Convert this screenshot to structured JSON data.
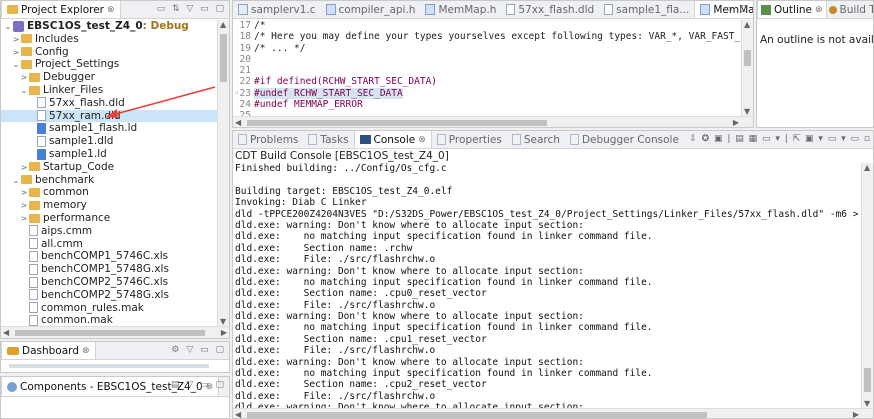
{
  "project_explorer": {
    "tab_label": "Project Explorer",
    "tab_close": "⊗",
    "items": [
      {
        "label": "EBSC1OS_test_Z4_0",
        "suffix": ": Debug",
        "icon": "project-icon",
        "twisty": "⌄"
      },
      {
        "label": "Includes",
        "icon": "includes-icon",
        "twisty": ">"
      },
      {
        "label": "Config",
        "icon": "folder-icon",
        "twisty": ">"
      },
      {
        "label": "Project_Settings",
        "icon": "folder-icon",
        "twisty": "⌄"
      },
      {
        "label": "Debugger",
        "icon": "folder-icon",
        "twisty": ">"
      },
      {
        "label": "Linker_Files",
        "icon": "folder-icon",
        "twisty": "⌄"
      },
      {
        "label": "57xx_flash.dld",
        "icon": "file-icon",
        "twisty": ""
      },
      {
        "label": "57xx_ram.dld",
        "icon": "file-icon",
        "twisty": ""
      },
      {
        "label": "sample1_flash.ld",
        "icon": "ld-file-icon",
        "twisty": ""
      },
      {
        "label": "sample1.dld",
        "icon": "file-icon",
        "twisty": ""
      },
      {
        "label": "sample1.ld",
        "icon": "ld-file-icon",
        "twisty": ""
      },
      {
        "label": "Startup_Code",
        "icon": "folder-icon",
        "twisty": ">"
      },
      {
        "label": "benchmark",
        "icon": "folder-icon",
        "twisty": "⌄"
      },
      {
        "label": "common",
        "icon": "folder-icon",
        "twisty": ">"
      },
      {
        "label": "memory",
        "icon": "folder-icon",
        "twisty": ">"
      },
      {
        "label": "performance",
        "icon": "folder-icon",
        "twisty": ">"
      },
      {
        "label": "aips.cmm",
        "icon": "file-icon",
        "twisty": ""
      },
      {
        "label": "all.cmm",
        "icon": "file-icon",
        "twisty": ""
      },
      {
        "label": "benchCOMP1_5746C.xls",
        "icon": "file-icon",
        "twisty": ""
      },
      {
        "label": "benchCOMP1_5748G.xls",
        "icon": "file-icon",
        "twisty": ""
      },
      {
        "label": "benchCOMP2_5746C.xls",
        "icon": "file-icon",
        "twisty": ""
      },
      {
        "label": "benchCOMP2_5748G.xls",
        "icon": "file-icon",
        "twisty": ""
      },
      {
        "label": "common_rules.mak",
        "icon": "file-icon",
        "twisty": ""
      },
      {
        "label": "common.mak",
        "icon": "file-icon",
        "twisty": ""
      }
    ]
  },
  "dashboard": {
    "tab_label": "Dashboard",
    "tab_close": "⊗"
  },
  "components": {
    "tab_label": "Components - EBSC1OS_test_Z4_0",
    "tab_close": "⊗"
  },
  "editor": {
    "tabs": [
      {
        "label": "samplerv1.c",
        "icon": "c-file-icon"
      },
      {
        "label": "compiler_api.h",
        "icon": "h-file-icon"
      },
      {
        "label": "MemMap.h",
        "icon": "h-file-icon"
      },
      {
        "label": "57xx_flash.dld",
        "icon": "file-icon"
      },
      {
        "label": "sample1_fla...",
        "icon": "file-icon"
      },
      {
        "label": "MemMap.h",
        "icon": "h-file-icon",
        "active": true,
        "close": "⊗"
      }
    ],
    "overflow": "»¹¹",
    "lines": [
      {
        "num": "17",
        "text": "/*"
      },
      {
        "num": "18",
        "text": "/* Here you may define your types yourselves except following types: VAR_*, VAR_FAST_*, CONST_*"
      },
      {
        "num": "19",
        "text": "/* ... */"
      },
      {
        "num": "20",
        "text": ""
      },
      {
        "num": "21",
        "text": ""
      },
      {
        "num": "22",
        "text": "#if defined(RCHW_START_SEC_DATA)"
      },
      {
        "num": "◦23",
        "text": "#undef RCHW_START_SEC_DATA"
      },
      {
        "num": "24",
        "text": "#undef MEMMAP_ERROR"
      },
      {
        "num": "25",
        "text": ""
      }
    ]
  },
  "outline": {
    "tab_label": "Outline",
    "tab_close": "⊗",
    "build_tab": "Build Ta...",
    "overflow": "»",
    "message": "An outline is not available."
  },
  "console": {
    "tabs": [
      {
        "label": "Problems",
        "icon": "problems-icon"
      },
      {
        "label": "Tasks",
        "icon": "tasks-icon"
      },
      {
        "label": "Console",
        "icon": "console-icon",
        "active": true,
        "close": "⊗"
      },
      {
        "label": "Properties",
        "icon": "properties-icon"
      },
      {
        "label": "Search",
        "icon": "search-icon"
      },
      {
        "label": "Debugger Console",
        "icon": "debugger-console-icon"
      }
    ],
    "title": "CDT Build Console [EBSC1OS_test_Z4_0]",
    "lines": [
      "Finished building: ../Config/Os_cfg.c",
      " ",
      "Building target: EBSC1OS_test_Z4_0.elf",
      "Invoking: Diab C Linker",
      "dld -tPPCE200Z4204N3VES \"D:/S32DS_Power/EBSC1OS_test_Z4_0/Project_Settings/Linker_Files/57xx_flash.dld\" -m6 > EBSC1OS_test_Z4",
      "dld.exe: warning: Don't know where to allocate input section:",
      "dld.exe:    no matching input specification found in linker command file.",
      "dld.exe:    Section name: .rchw",
      "dld.exe:    File: ./src/flashrchw.o",
      "dld.exe: warning: Don't know where to allocate input section:",
      "dld.exe:    no matching input specification found in linker command file.",
      "dld.exe:    Section name: .cpu0_reset_vector",
      "dld.exe:    File: ./src/flashrchw.o",
      "dld.exe: warning: Don't know where to allocate input section:",
      "dld.exe:    no matching input specification found in linker command file.",
      "dld.exe:    Section name: .cpu1_reset_vector",
      "dld.exe:    File: ./src/flashrchw.o",
      "dld.exe: warning: Don't know where to allocate input section:",
      "dld.exe:    no matching input specification found in linker command file.",
      "dld.exe:    Section name: .cpu2_reset_vector",
      "dld.exe:    File: ./src/flashrchw.o",
      "dld.exe: warning: Don't know where to allocate input section:",
      "dld.exe:    no matching input specification found in linker command file."
    ]
  },
  "colors": {
    "selection": "#cce4f7",
    "arrow": "#e8403a",
    "keyword": "#7f0055"
  }
}
